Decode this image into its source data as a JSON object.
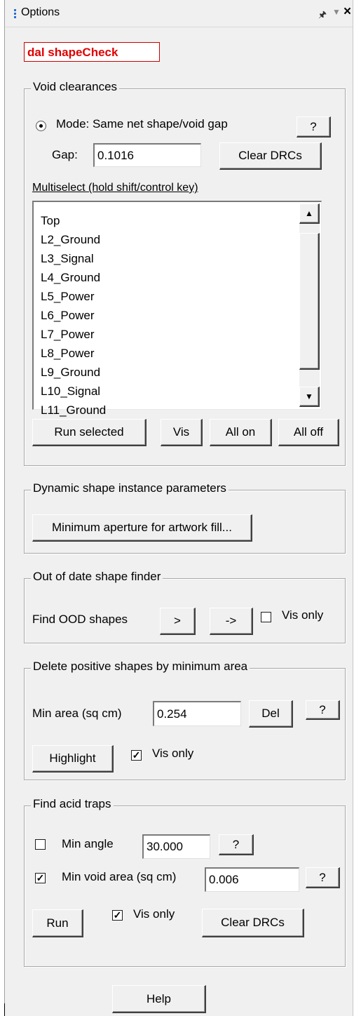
{
  "window": {
    "title": "Options"
  },
  "brand_label": "dal shapeCheck",
  "void_clearances": {
    "legend": "Void clearances",
    "mode_label": "Mode: Same net shape/void gap",
    "help_label": "?",
    "gap_label": "Gap:",
    "gap_value": "0.1016",
    "clear_label": "Clear DRCs",
    "multiselect_label": "Multiselect (hold shift/control key)",
    "layers": [
      "Top",
      "L2_Ground",
      "L3_Signal",
      "L4_Ground",
      "L5_Power",
      "L6_Power",
      "L7_Power",
      "L8_Power",
      "L9_Ground",
      "L10_Signal",
      "L11_Ground"
    ],
    "run_selected_label": "Run selected",
    "vis_label": "Vis",
    "all_on_label": "All on",
    "all_off_label": "All off"
  },
  "dynamic_shape": {
    "legend": "Dynamic shape instance parameters",
    "aperture_label": "Minimum aperture for artwork fill..."
  },
  "ood_finder": {
    "legend": "Out of date shape finder",
    "find_label": "Find OOD shapes",
    "next_label": ">",
    "arrow_label": "->",
    "vis_only_label": "Vis only",
    "vis_only_checked": false
  },
  "delete_positive": {
    "legend": "Delete positive shapes by minimum area",
    "min_area_label": "Min area (sq cm)",
    "min_area_value": "0.254",
    "del_label": "Del",
    "help_label": "?",
    "highlight_label": "Highlight",
    "vis_only_label": "Vis only",
    "vis_only_checked": true
  },
  "acid_traps": {
    "legend": "Find acid traps",
    "min_angle_label": "Min angle",
    "min_angle_checked": false,
    "min_angle_value": "30.000",
    "help1_label": "?",
    "min_void_label": "Min void area (sq cm)",
    "min_void_checked": true,
    "min_void_value": "0.006",
    "help2_label": "?",
    "run_label": "Run",
    "vis_only_label": "Vis only",
    "vis_only_checked": true,
    "clear_label": "Clear DRCs"
  },
  "help_button_label": "Help",
  "icons": {
    "grip": "grip-icon",
    "pin": "pin-icon",
    "dropdown": "dropdown-icon",
    "close": "close-icon"
  },
  "colors": {
    "brand_text": "#e00000",
    "brand_border": "#cc0000",
    "panel_bg": "#f0f0f0",
    "grip": "#2a6fd8"
  }
}
